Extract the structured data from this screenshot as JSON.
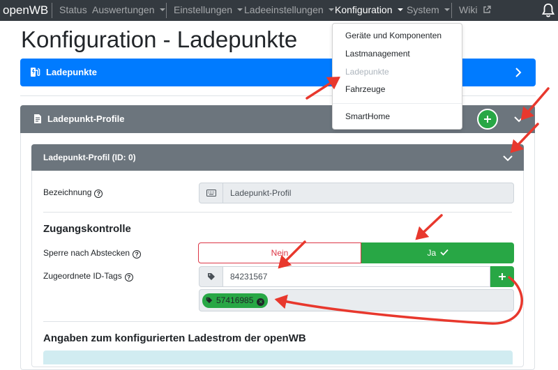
{
  "navbar": {
    "brand": "openWB",
    "items": [
      {
        "label": "Status"
      },
      {
        "label": "Auswertungen"
      },
      {
        "label": "Einstellungen"
      },
      {
        "label": "Ladeeinstellungen"
      },
      {
        "label": "Konfiguration"
      },
      {
        "label": "System"
      },
      {
        "label": "Wiki"
      }
    ]
  },
  "dropdown": {
    "items": [
      {
        "label": "Geräte und Komponenten"
      },
      {
        "label": "Lastmanagement"
      },
      {
        "label": "Ladepunkte"
      },
      {
        "label": "Fahrzeuge"
      },
      {
        "label": "SmartHome"
      }
    ]
  },
  "page": {
    "title": "Konfiguration - Ladepunkte"
  },
  "ladepunkte_bar": {
    "label": "Ladepunkte"
  },
  "profiles_card": {
    "title": "Ladepunkt-Profile"
  },
  "profile_card": {
    "title": "Ladepunkt-Profil (ID: 0)",
    "bezeichnung": {
      "label": "Bezeichnung",
      "value": "Ladepunkt-Profil"
    },
    "zugang": {
      "heading": "Zugangskontrolle",
      "sperre_label": "Sperre nach Abstecken",
      "nein": "Nein",
      "ja": "Ja",
      "idtags_label": "Zugeordnete ID-Tags",
      "idtag_input": "84231567",
      "tags": [
        "57416985"
      ]
    },
    "ladestrom_heading": "Angaben zum konfigurierten Ladestrom der openWB"
  },
  "colors": {
    "navbar": "#343a40",
    "primary": "#007bff",
    "secondary": "#6c757d",
    "success": "#28a745",
    "danger": "#dc3545",
    "annotation": "#e8382d"
  }
}
